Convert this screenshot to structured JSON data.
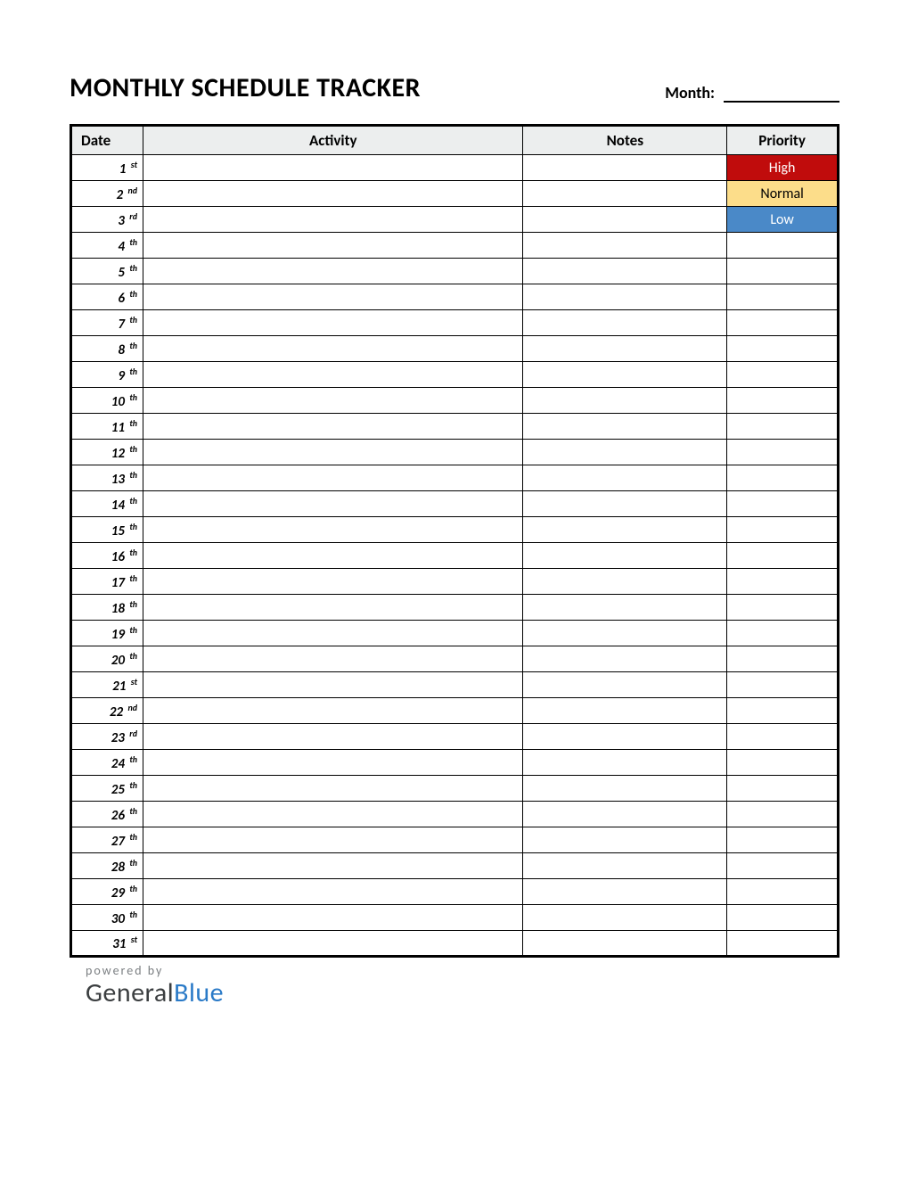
{
  "header": {
    "title": "MONTHLY SCHEDULE TRACKER",
    "month_label": "Month:",
    "month_value": ""
  },
  "columns": {
    "date": "Date",
    "activity": "Activity",
    "notes": "Notes",
    "priority": "Priority"
  },
  "priority_levels": {
    "high": {
      "label": "High",
      "bg": "#c00c0c",
      "fg": "#ffffff"
    },
    "normal": {
      "label": "Normal",
      "bg": "#fcdd8a",
      "fg": "#000000"
    },
    "low": {
      "label": "Low",
      "bg": "#4a89c8",
      "fg": "#ffffff"
    }
  },
  "rows": [
    {
      "day": "1",
      "ord": "st",
      "activity": "",
      "notes": "",
      "priority": "High"
    },
    {
      "day": "2",
      "ord": "nd",
      "activity": "",
      "notes": "",
      "priority": "Normal"
    },
    {
      "day": "3",
      "ord": "rd",
      "activity": "",
      "notes": "",
      "priority": "Low"
    },
    {
      "day": "4",
      "ord": "th",
      "activity": "",
      "notes": "",
      "priority": ""
    },
    {
      "day": "5",
      "ord": "th",
      "activity": "",
      "notes": "",
      "priority": ""
    },
    {
      "day": "6",
      "ord": "th",
      "activity": "",
      "notes": "",
      "priority": ""
    },
    {
      "day": "7",
      "ord": "th",
      "activity": "",
      "notes": "",
      "priority": ""
    },
    {
      "day": "8",
      "ord": "th",
      "activity": "",
      "notes": "",
      "priority": ""
    },
    {
      "day": "9",
      "ord": "th",
      "activity": "",
      "notes": "",
      "priority": ""
    },
    {
      "day": "10",
      "ord": "th",
      "activity": "",
      "notes": "",
      "priority": ""
    },
    {
      "day": "11",
      "ord": "th",
      "activity": "",
      "notes": "",
      "priority": ""
    },
    {
      "day": "12",
      "ord": "th",
      "activity": "",
      "notes": "",
      "priority": ""
    },
    {
      "day": "13",
      "ord": "th",
      "activity": "",
      "notes": "",
      "priority": ""
    },
    {
      "day": "14",
      "ord": "th",
      "activity": "",
      "notes": "",
      "priority": ""
    },
    {
      "day": "15",
      "ord": "th",
      "activity": "",
      "notes": "",
      "priority": ""
    },
    {
      "day": "16",
      "ord": "th",
      "activity": "",
      "notes": "",
      "priority": ""
    },
    {
      "day": "17",
      "ord": "th",
      "activity": "",
      "notes": "",
      "priority": ""
    },
    {
      "day": "18",
      "ord": "th",
      "activity": "",
      "notes": "",
      "priority": ""
    },
    {
      "day": "19",
      "ord": "th",
      "activity": "",
      "notes": "",
      "priority": ""
    },
    {
      "day": "20",
      "ord": "th",
      "activity": "",
      "notes": "",
      "priority": ""
    },
    {
      "day": "21",
      "ord": "st",
      "activity": "",
      "notes": "",
      "priority": ""
    },
    {
      "day": "22",
      "ord": "nd",
      "activity": "",
      "notes": "",
      "priority": ""
    },
    {
      "day": "23",
      "ord": "rd",
      "activity": "",
      "notes": "",
      "priority": ""
    },
    {
      "day": "24",
      "ord": "th",
      "activity": "",
      "notes": "",
      "priority": ""
    },
    {
      "day": "25",
      "ord": "th",
      "activity": "",
      "notes": "",
      "priority": ""
    },
    {
      "day": "26",
      "ord": "th",
      "activity": "",
      "notes": "",
      "priority": ""
    },
    {
      "day": "27",
      "ord": "th",
      "activity": "",
      "notes": "",
      "priority": ""
    },
    {
      "day": "28",
      "ord": "th",
      "activity": "",
      "notes": "",
      "priority": ""
    },
    {
      "day": "29",
      "ord": "th",
      "activity": "",
      "notes": "",
      "priority": ""
    },
    {
      "day": "30",
      "ord": "th",
      "activity": "",
      "notes": "",
      "priority": ""
    },
    {
      "day": "31",
      "ord": "st",
      "activity": "",
      "notes": "",
      "priority": ""
    }
  ],
  "footer": {
    "powered_by": "powered by",
    "brand_general": "General",
    "brand_blue": "Blue"
  }
}
